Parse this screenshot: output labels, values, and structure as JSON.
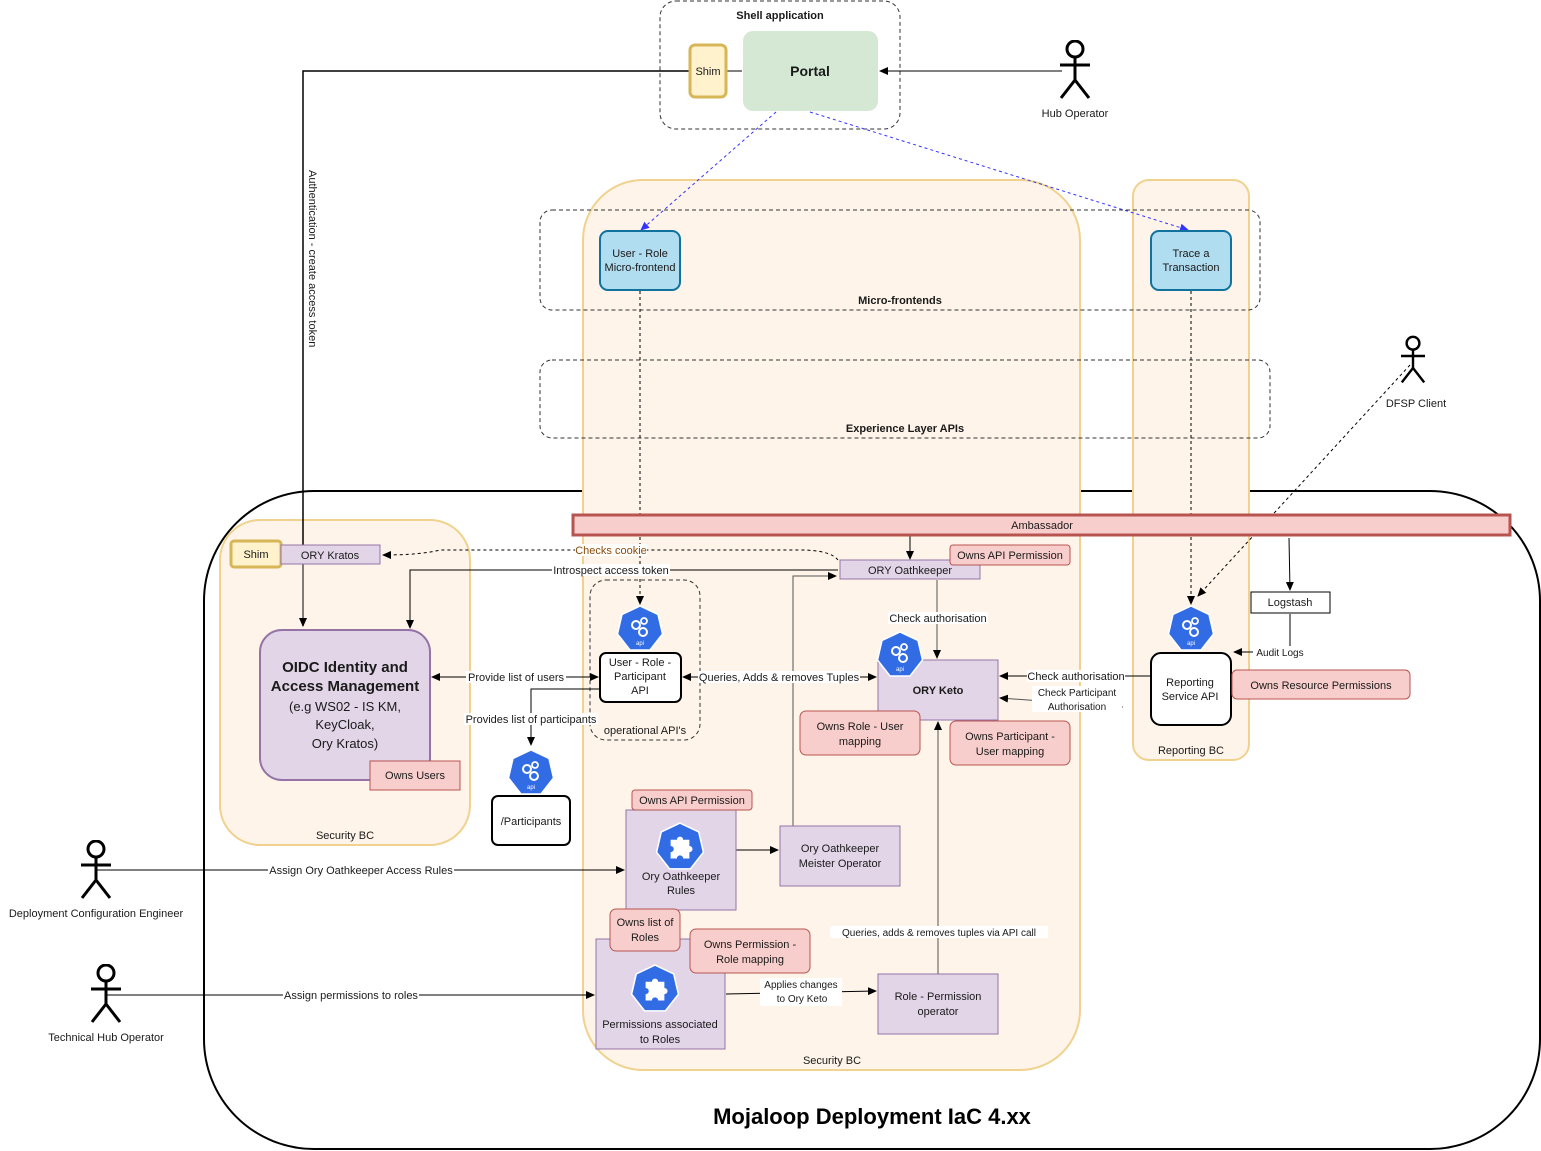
{
  "diagram_title": "Mojaloop Deployment IaC 4.xx",
  "containers": {
    "shell_app": "Shell application",
    "micro_frontends": "Micro-frontends",
    "experience_layer": "Experience Layer APIs",
    "security_bc_left": "Security BC",
    "security_bc_center": "Security BC",
    "reporting_bc": "Reporting BC",
    "operational_apis": "operational API's"
  },
  "nodes": {
    "shim_top": "Shim",
    "portal": "Portal",
    "user_role_mfe": [
      "User - Role",
      "Micro-frontend"
    ],
    "trace_tx": [
      "Trace a",
      "Transaction"
    ],
    "ambassador": "Ambassador",
    "shim_kratos": "Shim",
    "ory_kratos": "ORY Kratos",
    "oidc": {
      "title": [
        "OIDC Identity and",
        "Access Management"
      ],
      "subtitle": [
        "(e.g WS02 - IS KM,",
        "KeyCloak,",
        "Ory Kratos)"
      ]
    },
    "owns_users": "Owns Users",
    "user_role_participant_api": [
      "User - Role -",
      "Participant",
      "API"
    ],
    "participants": "/Participants",
    "ory_oathkeeper": "ORY Oathkeeper",
    "owns_api_permission_top": "Owns API Permission",
    "ory_keto": "ORY Keto",
    "owns_role_user": [
      "Owns Role - User",
      "mapping"
    ],
    "owns_participant_user": [
      "Owns Participant -",
      "User mapping"
    ],
    "owns_api_permission_rules": "Owns API Permission",
    "oathkeeper_rules": [
      "Ory Oathkeeper",
      "Rules"
    ],
    "meister_operator": [
      "Ory Oathkeeper",
      "Meister Operator"
    ],
    "owns_list_roles": [
      "Owns list of",
      "Roles"
    ],
    "owns_permission_role": [
      "Owns Permission -",
      "Role mapping"
    ],
    "permissions_roles": [
      "Permissions associated",
      "to Roles"
    ],
    "role_permission_operator": [
      "Role - Permission",
      "operator"
    ],
    "logstash": "Logstash",
    "reporting_api": [
      "Reporting",
      "Service API"
    ],
    "owns_resource_permissions": "Owns Resource Permissions",
    "api_icon_label": "api"
  },
  "actors": {
    "hub_operator": "Hub Operator",
    "dfsp_client": "DFSP Client",
    "deployment_engineer": "Deployment Configuration Engineer",
    "technical_hub_operator": "Technical Hub Operator"
  },
  "edges": {
    "auth_token": "Authentication - create access token",
    "checks_cookie": "Checks cookie",
    "introspect": "Introspect access token",
    "provide_users": "Provide list of users",
    "provides_participants": "Provides list of participants",
    "queries_tuples": "Queries, Adds & removes Tuples",
    "check_authorisation_top": "Check authorisation",
    "check_authorisation_right": "Check authorisation",
    "check_participant_auth": [
      "Check Participant",
      "Authorisation"
    ],
    "audit_logs": "Audit Logs",
    "assign_rules": "Assign Ory Oathkeeper Access Rules",
    "assign_permissions": "Assign permissions to roles",
    "applies_changes": [
      "Applies changes",
      "to Ory Keto"
    ],
    "queries_via_api": "Queries, adds & removes tuples via API call"
  },
  "colors": {
    "bc_fill": "#fef4e9",
    "bc_stroke": "#f0d28e",
    "purple_fill": "#e1d5e7",
    "purple_stroke": "#9673a6",
    "red_fill": "#f8cecc",
    "red_stroke": "#b85450",
    "blue_fill": "#b1ddf0",
    "blue_stroke": "#10739e",
    "green_fill": "#d5e8d4",
    "shim_fill": "#fff2cc",
    "shim_stroke": "#d6b656",
    "k8s_blue": "#326ce5",
    "link_blue": "#3333ff"
  }
}
